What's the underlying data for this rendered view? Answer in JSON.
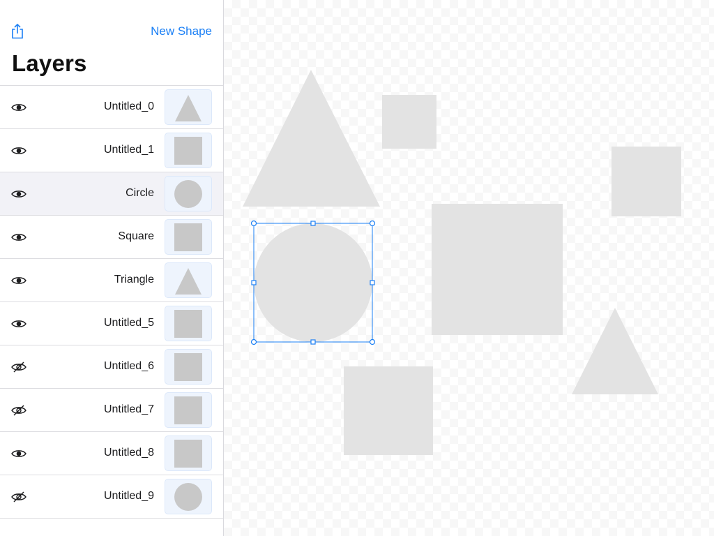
{
  "toolbar": {
    "share_icon": "share-icon",
    "new_shape_label": "New Shape"
  },
  "sidebar": {
    "title": "Layers",
    "layers": [
      {
        "name": "Untitled_0",
        "visible": true,
        "shape": "triangle",
        "selected": false
      },
      {
        "name": "Untitled_1",
        "visible": true,
        "shape": "square",
        "selected": false
      },
      {
        "name": "Circle",
        "visible": true,
        "shape": "circle",
        "selected": true
      },
      {
        "name": "Square",
        "visible": true,
        "shape": "square",
        "selected": false
      },
      {
        "name": "Triangle",
        "visible": true,
        "shape": "triangle",
        "selected": false
      },
      {
        "name": "Untitled_5",
        "visible": true,
        "shape": "square",
        "selected": false
      },
      {
        "name": "Untitled_6",
        "visible": false,
        "shape": "square",
        "selected": false
      },
      {
        "name": "Untitled_7",
        "visible": false,
        "shape": "square",
        "selected": false
      },
      {
        "name": "Untitled_8",
        "visible": true,
        "shape": "square",
        "selected": false
      },
      {
        "name": "Untitled_9",
        "visible": false,
        "shape": "circle",
        "selected": false
      }
    ]
  },
  "colors": {
    "accent": "#1a7ff5",
    "shape_fill": "#e3e3e3",
    "thumb_shape_fill": "#c8c8c8",
    "selected_row": "#f2f2f7"
  }
}
